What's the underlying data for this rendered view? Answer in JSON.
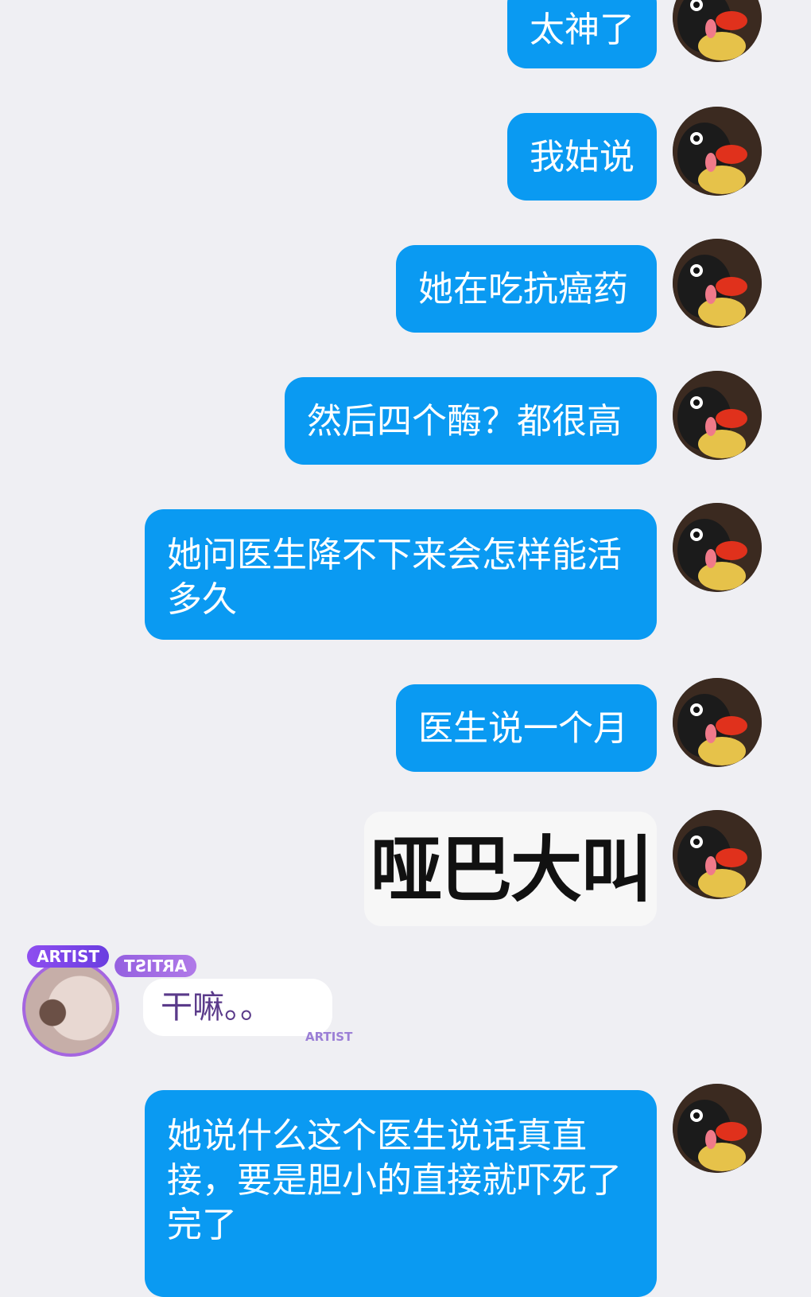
{
  "messages": [
    {
      "text": "太神了"
    },
    {
      "text": "我姑说"
    },
    {
      "text": "她在吃抗癌药"
    },
    {
      "text": "然后四个酶？都很高"
    },
    {
      "text": "她问医生降不下来会怎样能活多久"
    },
    {
      "text": "医生说一个月"
    },
    {
      "sticker_text": "哑巴大叫"
    },
    {
      "incoming_text": "干嘛。。"
    },
    {
      "text": "她说什么这个医生说话真直接，要是胆小的直接就吓死了完了"
    }
  ],
  "incoming": {
    "badge": "ARTIST",
    "badge_mirror": "ARTIST",
    "mark": "ARTIST"
  },
  "colors": {
    "outgoing_bubble": "#0a9af2",
    "background": "#efeff3",
    "artist_purple": "#8e4ef0"
  },
  "icons": {
    "self_avatar": "penguin-avatar-icon",
    "incoming_avatar": "user-avatar-icon"
  }
}
